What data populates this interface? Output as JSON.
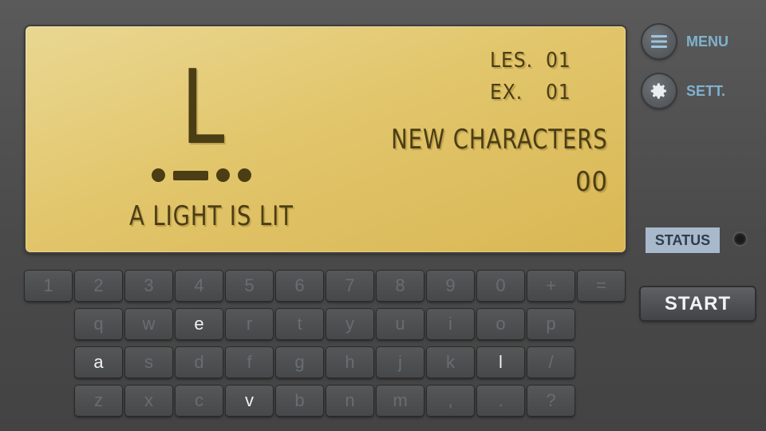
{
  "lcd": {
    "character": "L",
    "morse": [
      "dot",
      "dash",
      "dot",
      "dot"
    ],
    "meaning": "A LIGHT IS LIT",
    "lesson_label": "LES.",
    "lesson_value": "01",
    "exercise_label": "EX.",
    "exercise_value": "01",
    "new_characters_label": "NEW CHARACTERS",
    "new_characters_value": "00"
  },
  "side": {
    "menu_label": "MENU",
    "settings_label": "SETT.",
    "menu_icon": "hamburger-icon",
    "settings_icon": "gear-icon",
    "status_label": "STATUS",
    "start_label": "START"
  },
  "colors": {
    "lcd_background": "#e2c66c",
    "lcd_text": "#4b3d14",
    "accent": "#7fb2cf",
    "status_badge": "#a8b9cc"
  },
  "keyboard": {
    "rows": [
      [
        {
          "label": "1",
          "active": false
        },
        {
          "label": "2",
          "active": false
        },
        {
          "label": "3",
          "active": false
        },
        {
          "label": "4",
          "active": false
        },
        {
          "label": "5",
          "active": false
        },
        {
          "label": "6",
          "active": false
        },
        {
          "label": "7",
          "active": false
        },
        {
          "label": "8",
          "active": false
        },
        {
          "label": "9",
          "active": false
        },
        {
          "label": "0",
          "active": false
        },
        {
          "label": "+",
          "active": false
        },
        {
          "label": "=",
          "active": false
        }
      ],
      [
        {
          "label": "q",
          "active": false
        },
        {
          "label": "w",
          "active": false
        },
        {
          "label": "e",
          "active": true
        },
        {
          "label": "r",
          "active": false
        },
        {
          "label": "t",
          "active": false
        },
        {
          "label": "y",
          "active": false
        },
        {
          "label": "u",
          "active": false
        },
        {
          "label": "i",
          "active": false
        },
        {
          "label": "o",
          "active": false
        },
        {
          "label": "p",
          "active": false
        }
      ],
      [
        {
          "label": "a",
          "active": true
        },
        {
          "label": "s",
          "active": false
        },
        {
          "label": "d",
          "active": false
        },
        {
          "label": "f",
          "active": false
        },
        {
          "label": "g",
          "active": false
        },
        {
          "label": "h",
          "active": false
        },
        {
          "label": "j",
          "active": false
        },
        {
          "label": "k",
          "active": false
        },
        {
          "label": "l",
          "active": true
        },
        {
          "label": "/",
          "active": false
        }
      ],
      [
        {
          "label": "z",
          "active": false
        },
        {
          "label": "x",
          "active": false
        },
        {
          "label": "c",
          "active": false
        },
        {
          "label": "v",
          "active": true
        },
        {
          "label": "b",
          "active": false
        },
        {
          "label": "n",
          "active": false
        },
        {
          "label": "m",
          "active": false
        },
        {
          "label": ",",
          "active": false
        },
        {
          "label": ".",
          "active": false
        },
        {
          "label": "?",
          "active": false
        }
      ]
    ]
  }
}
